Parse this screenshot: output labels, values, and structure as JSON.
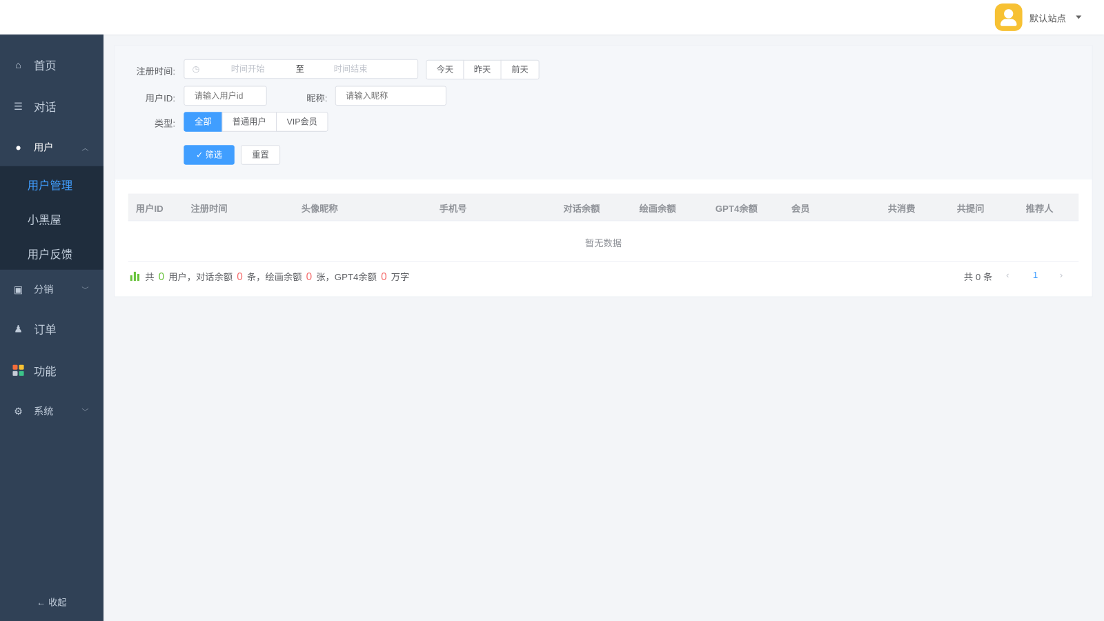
{
  "header": {
    "site_name": "默认站点"
  },
  "sidebar": {
    "items": [
      {
        "label": "首页",
        "icon": "home-icon"
      },
      {
        "label": "对话",
        "icon": "list-icon"
      },
      {
        "label": "用户",
        "icon": "user-icon",
        "expanded": true,
        "children": [
          {
            "label": "用户管理",
            "active": true
          },
          {
            "label": "小黑屋"
          },
          {
            "label": "用户反馈"
          }
        ]
      },
      {
        "label": "分销",
        "icon": "money-icon"
      },
      {
        "label": "订单",
        "icon": "money-bag-icon"
      },
      {
        "label": "功能",
        "icon": "grid-icon"
      },
      {
        "label": "系统",
        "icon": "gear-icon"
      }
    ],
    "collapse_label": "收起"
  },
  "filter": {
    "reg_time_label": "注册时间:",
    "start_placeholder": "时间开始",
    "range_sep": "至",
    "end_placeholder": "时间结束",
    "quick": [
      "今天",
      "昨天",
      "前天"
    ],
    "uid_label": "用户ID:",
    "uid_placeholder": "请输入用户id",
    "nick_label": "昵称:",
    "nick_placeholder": "请输入昵称",
    "type_label": "类型:",
    "types": [
      "全部",
      "普通用户",
      "VIP会员"
    ],
    "submit": "筛选",
    "reset": "重置"
  },
  "table": {
    "columns": [
      "用户ID",
      "注册时间",
      "头像昵称",
      "手机号",
      "对话余额",
      "绘画余额",
      "GPT4余额",
      "会员",
      "共消费",
      "共提问",
      "推荐人"
    ],
    "empty_text": "暂无数据"
  },
  "summary": {
    "t1": "共",
    "users": "0",
    "t2": "用户，对话余额",
    "chat": "0",
    "t3": "条，绘画余额",
    "draw": "0",
    "t4": "张，GPT4余额",
    "gpt4": "0",
    "t5": "万字"
  },
  "pagination": {
    "total": "共 0 条",
    "current": "1"
  },
  "colors": {
    "sidebar": "#304156",
    "submenu": "#1f2d3d",
    "primary": "#409eff",
    "green": "#67c23a",
    "red": "#f56c6c"
  }
}
